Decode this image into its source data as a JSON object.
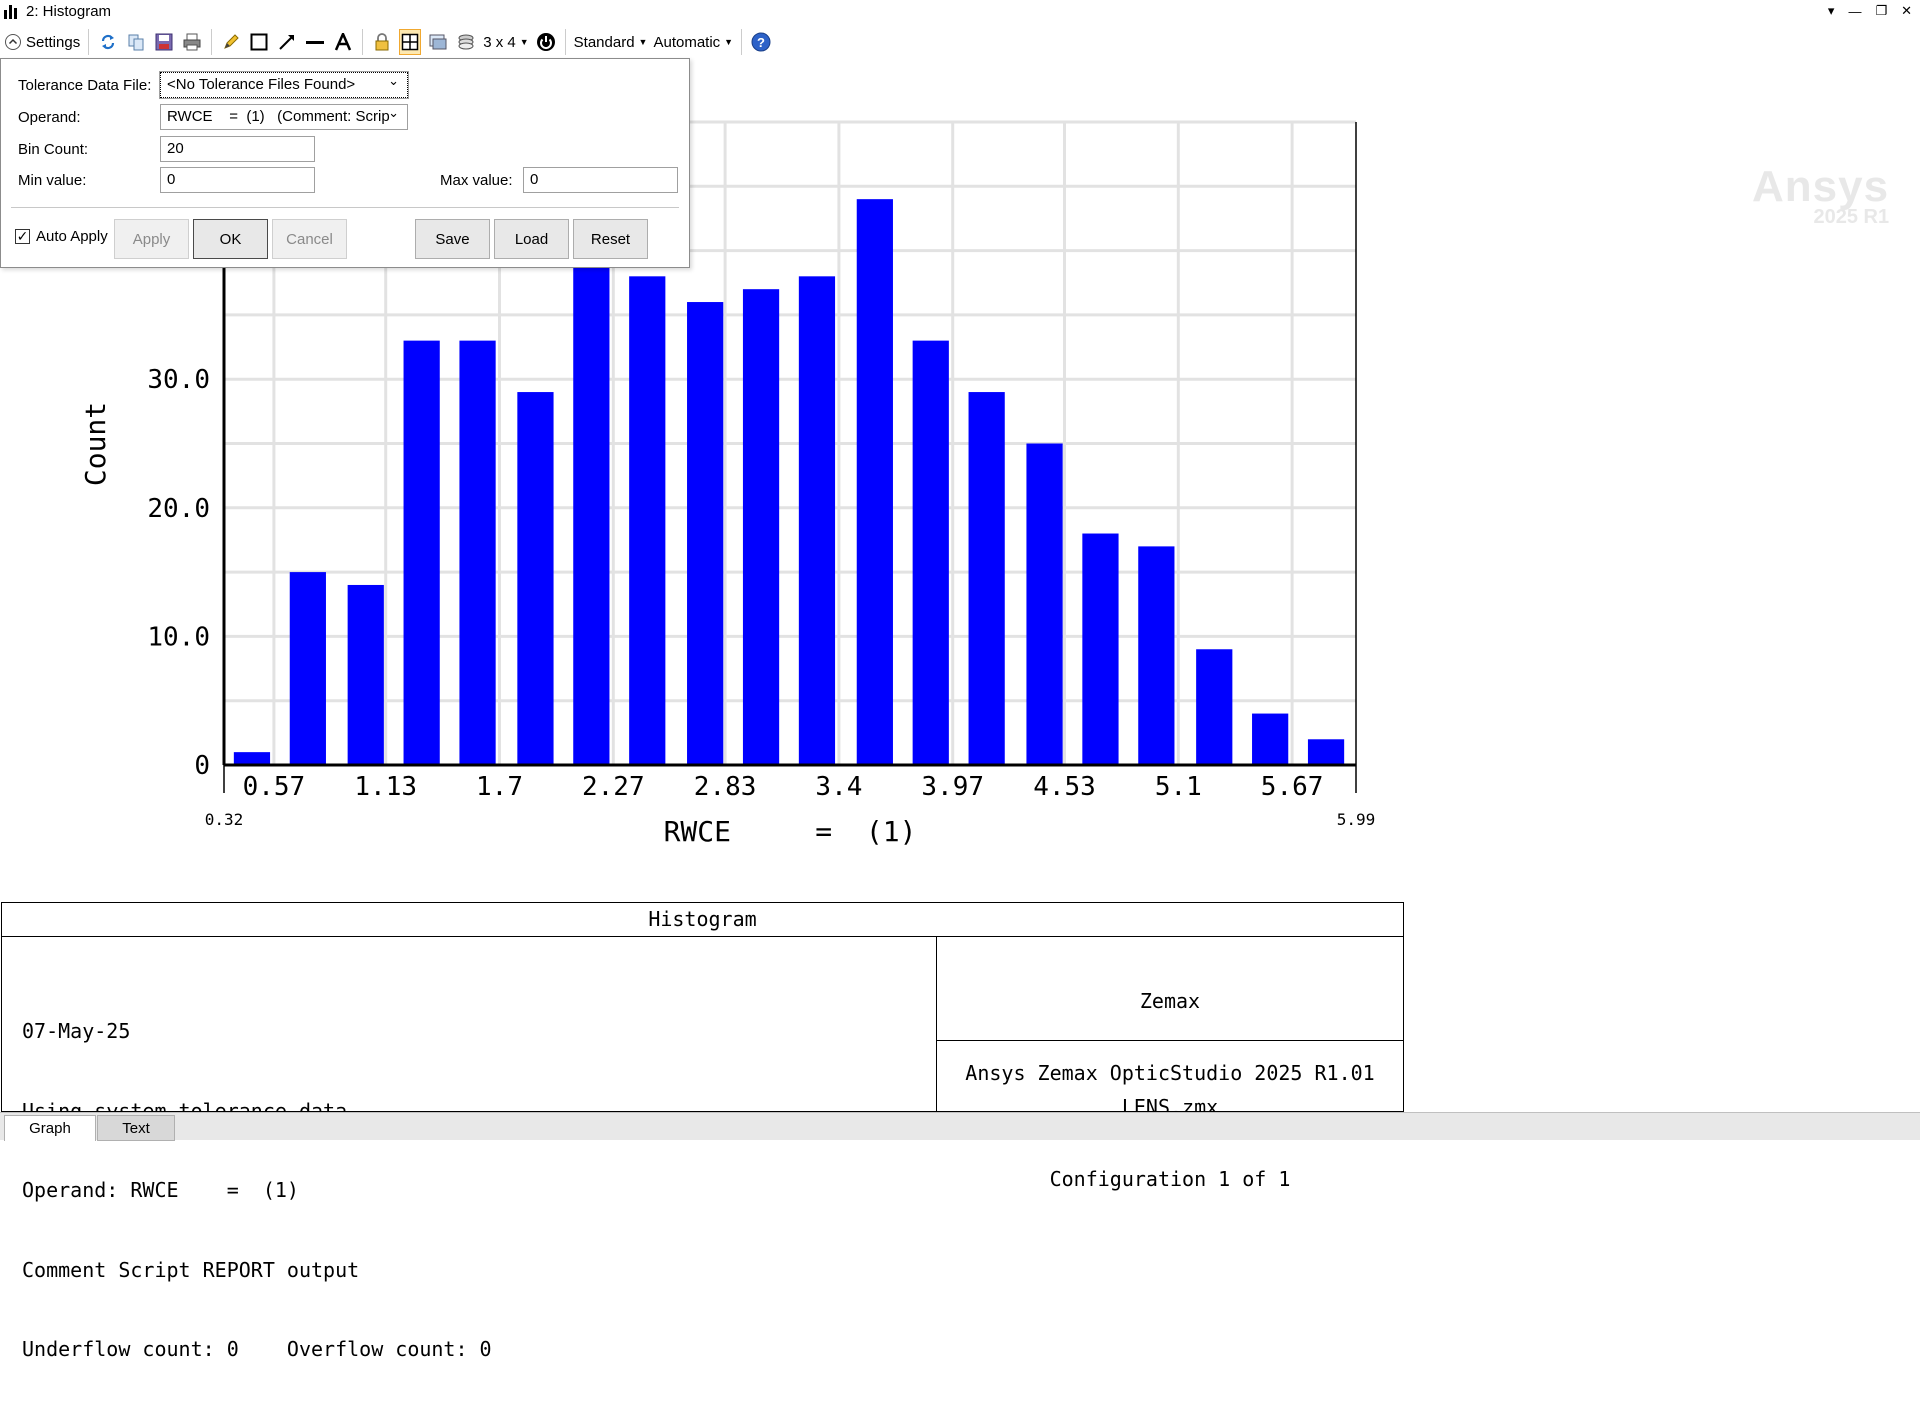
{
  "window": {
    "title": "2: Histogram",
    "controls": [
      "▾",
      "—",
      "❐",
      "✕"
    ]
  },
  "toolbar": {
    "settings_label": "Settings",
    "grid_label": "3 x 4",
    "standard_label": "Standard",
    "automatic_label": "Automatic",
    "help_symbol": "?",
    "icons": [
      "refresh-icon",
      "copy-icon",
      "save-icon",
      "print-icon",
      "pencil-icon",
      "rectangle-icon",
      "arrow-line-icon",
      "line-icon",
      "text-icon",
      "lock-icon",
      "clipboard-grid-icon",
      "window-icon",
      "layers-icon",
      "grid-icon",
      "power-icon",
      "help-icon"
    ]
  },
  "settings": {
    "tolerance_label": "Tolerance Data File:",
    "tolerance_value": "<No Tolerance Files Found>",
    "operand_label": "Operand:",
    "operand_value": "RWCE    =  (1)   (Comment: Scrip",
    "bin_count_label": "Bin Count:",
    "bin_count_value": "20",
    "min_label": "Min value:",
    "min_value": "0",
    "max_label": "Max value:",
    "max_value": "0",
    "auto_apply_label": "Auto Apply",
    "auto_apply_checked": true,
    "apply_label": "Apply",
    "ok_label": "OK",
    "cancel_label": "Cancel",
    "save_label": "Save",
    "load_label": "Load",
    "reset_label": "Reset"
  },
  "watermark": {
    "brand": "Ansys",
    "version": "2025 R1"
  },
  "chart_data": {
    "type": "bar",
    "title": "",
    "xlabel": "RWCE     =  (1)",
    "ylabel": "Count",
    "x_min_label": "0.32",
    "x_max_label": "5.99",
    "xlim": [
      0.32,
      5.99
    ],
    "ylim": [
      0,
      50
    ],
    "y_ticks": [
      {
        "value": 0,
        "label": "0"
      },
      {
        "value": 10,
        "label": "10.0"
      },
      {
        "value": 20,
        "label": "20.0"
      },
      {
        "value": 30,
        "label": "30.0"
      }
    ],
    "x_ticks": [
      {
        "value": 0.57,
        "label": "0.57"
      },
      {
        "value": 1.13,
        "label": "1.13"
      },
      {
        "value": 1.7,
        "label": "1.7"
      },
      {
        "value": 2.27,
        "label": "2.27"
      },
      {
        "value": 2.83,
        "label": "2.83"
      },
      {
        "value": 3.4,
        "label": "3.4"
      },
      {
        "value": 3.97,
        "label": "3.97"
      },
      {
        "value": 4.53,
        "label": "4.53"
      },
      {
        "value": 5.1,
        "label": "5.1"
      },
      {
        "value": 5.67,
        "label": "5.67"
      }
    ],
    "bin_centers": [
      0.46,
      0.74,
      1.03,
      1.31,
      1.59,
      1.88,
      2.16,
      2.44,
      2.73,
      3.01,
      3.29,
      3.58,
      3.86,
      4.14,
      4.43,
      4.71,
      4.99,
      5.28,
      5.56,
      5.84
    ],
    "values": [
      1,
      15,
      14,
      33,
      33,
      29,
      41,
      38,
      36,
      37,
      38,
      44,
      33,
      29,
      25,
      18,
      17,
      9,
      4,
      2
    ],
    "bar_color": "#0000ff",
    "grid": true
  },
  "info": {
    "header": "Histogram",
    "left_lines": [
      "07-May-25",
      "Using system tolerance data.",
      "Operand: RWCE    =  (1)",
      "Comment Script REPORT output",
      "Underflow count: 0    Overflow count: 0"
    ],
    "right_top_lines": [
      "Zemax",
      "Ansys Zemax OpticStudio 2025 R1.01"
    ],
    "right_bottom_lines": [
      "LENS.zmx",
      "Configuration 1 of 1"
    ]
  },
  "tabs": [
    {
      "label": "Graph",
      "active": true
    },
    {
      "label": "Text",
      "active": false
    }
  ]
}
